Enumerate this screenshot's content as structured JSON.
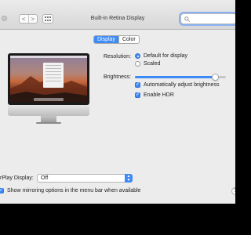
{
  "window": {
    "title": "Built-in Retina Display",
    "nav_back": "<",
    "nav_forward": ">",
    "search_placeholder": ""
  },
  "tabs": [
    {
      "label": "Display",
      "active": true
    },
    {
      "label": "Color",
      "active": false
    }
  ],
  "monitor": {
    "logo_glyph": ""
  },
  "resolution": {
    "label": "Resolution:",
    "options": [
      {
        "label": "Default for display",
        "selected": true
      },
      {
        "label": "Scaled",
        "selected": false
      }
    ]
  },
  "brightness": {
    "label": "Brightness:",
    "level": 0.92,
    "auto_adjust": {
      "label": "Automatically adjust brightness",
      "checked": true
    },
    "hdr": {
      "label": "Enable HDR",
      "checked": true
    }
  },
  "airplay": {
    "label": "rPlay Display:",
    "value": "Off",
    "mirroring": {
      "label": "Show mirroring options in the menu bar when available",
      "checked": true
    }
  },
  "help": {
    "glyph": "?"
  },
  "colors": {
    "accent": "#3d8af7",
    "window_bg": "#ececec",
    "desktop": "#000000"
  }
}
